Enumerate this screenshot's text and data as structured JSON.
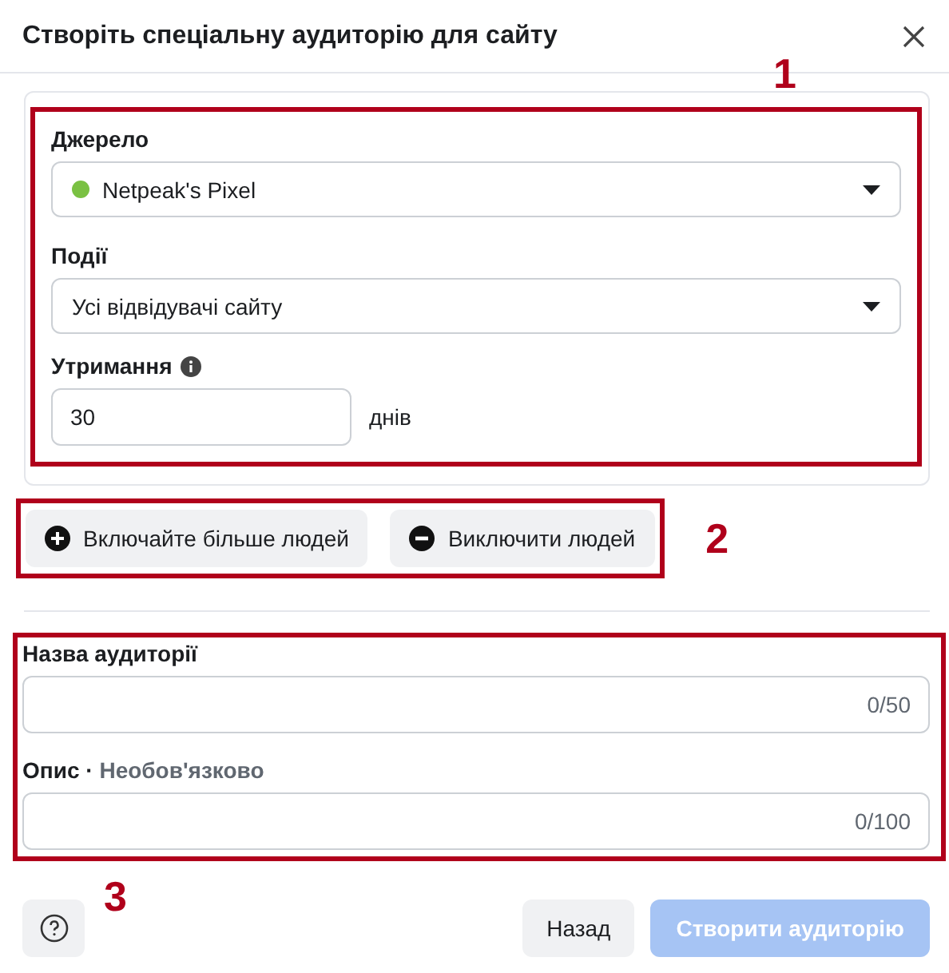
{
  "dialog": {
    "title": "Створіть спеціальну аудиторію для сайту"
  },
  "callouts": [
    "1",
    "2",
    "3"
  ],
  "source": {
    "label": "Джерело",
    "value": "Netpeak's Pixel",
    "color": "#7ac143"
  },
  "events": {
    "label": "Події",
    "value": "Усі відвідувачі сайту"
  },
  "retention": {
    "label": "Утримання",
    "value": "30",
    "unit": "днів"
  },
  "actions": [
    {
      "kind": "include",
      "label": "Включайте більше людей"
    },
    {
      "kind": "exclude",
      "label": "Виключити людей"
    }
  ],
  "name_field": {
    "label": "Назва аудиторії",
    "counter": "0/50"
  },
  "description_field": {
    "label": "Опис",
    "separator": "·",
    "note": "Необов'язково",
    "counter": "0/100"
  },
  "footer": {
    "back": "Назад",
    "create": {
      "label": "Створити аудиторію",
      "disabled": true
    }
  }
}
